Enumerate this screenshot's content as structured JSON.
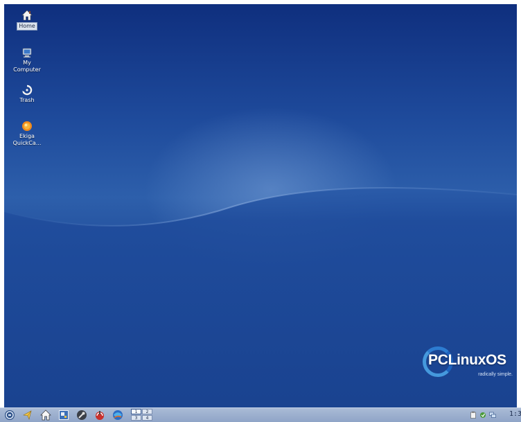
{
  "desktop": {
    "icons": [
      {
        "name": "home",
        "label": "Home",
        "selected": true
      },
      {
        "name": "my-computer",
        "label": "My\nComputer"
      },
      {
        "name": "trash",
        "label": "Trash"
      },
      {
        "name": "ekiga",
        "label": "Ekiga\nQuickCa..."
      }
    ]
  },
  "branding": {
    "logo_text": "PCLinuxOS",
    "tagline": "radically simple."
  },
  "taskbar": {
    "launchers": [
      "pclinuxos-menu-icon",
      "file-manager-icon",
      "home-folder-icon",
      "control-center-icon",
      "settings-tool-icon",
      "software-manager-icon",
      "browser-icon"
    ],
    "pager": {
      "desktops": [
        "1",
        "2",
        "3",
        "4"
      ],
      "active": "1"
    },
    "clock": "1:3"
  },
  "colors": {
    "desktop_top": "#0f2f7e",
    "desktop_mid": "#2d5fab",
    "taskbar": "#9fb2d1",
    "logo_accent": "#4aa3e6"
  }
}
